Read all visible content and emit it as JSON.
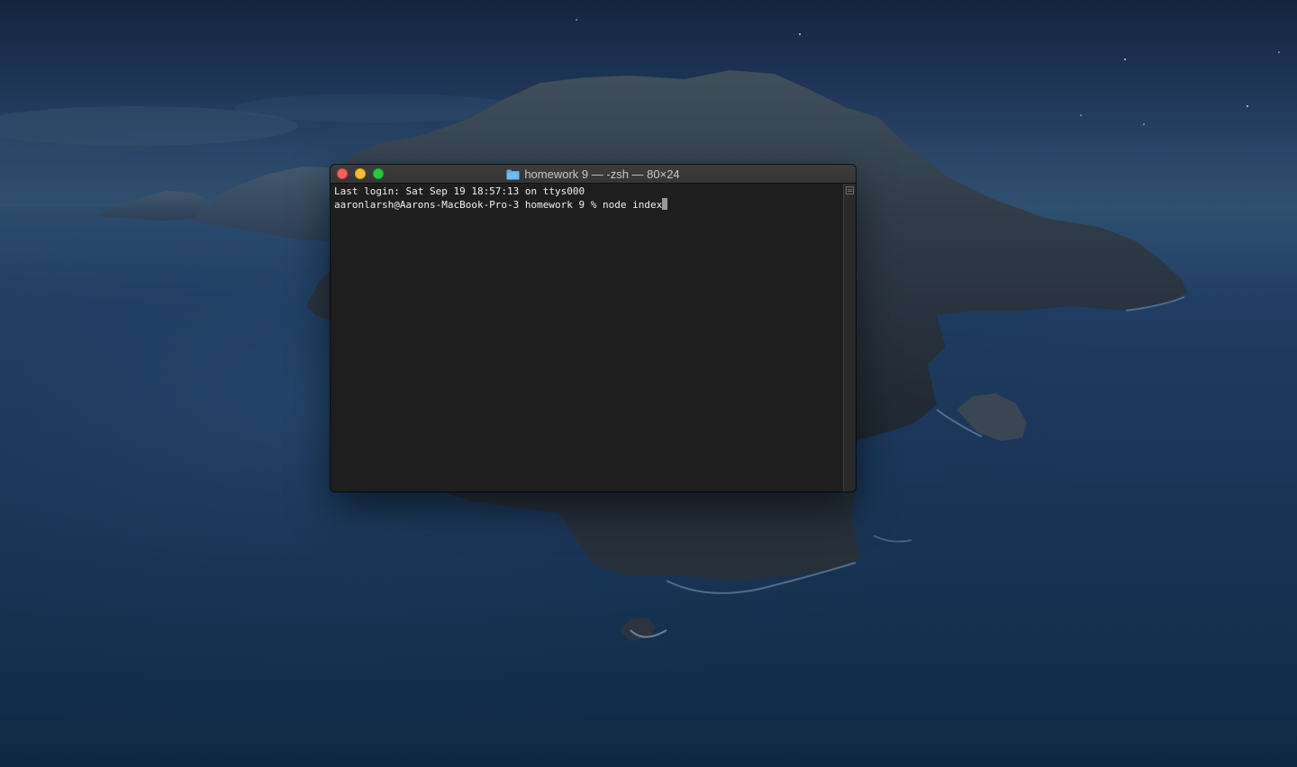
{
  "terminal": {
    "title": "homework 9 — -zsh — 80×24",
    "lines": [
      "Last login: Sat Sep 19 18:57:13 on ttys000",
      "aaronlarsh@Aarons-MacBook-Pro-3 homework 9 % node index"
    ]
  },
  "icons": {
    "folder": "folder-icon",
    "close": "close-icon",
    "minimize": "minimize-icon",
    "zoom": "zoom-icon",
    "split": "split-pane-icon",
    "cursor": "text-cursor"
  },
  "colors": {
    "close": "#fe5f57",
    "minimize": "#febc2e",
    "zoom": "#28c840",
    "terminal_background": "#1e1e1e",
    "terminal_text": "#f0f0f0"
  }
}
